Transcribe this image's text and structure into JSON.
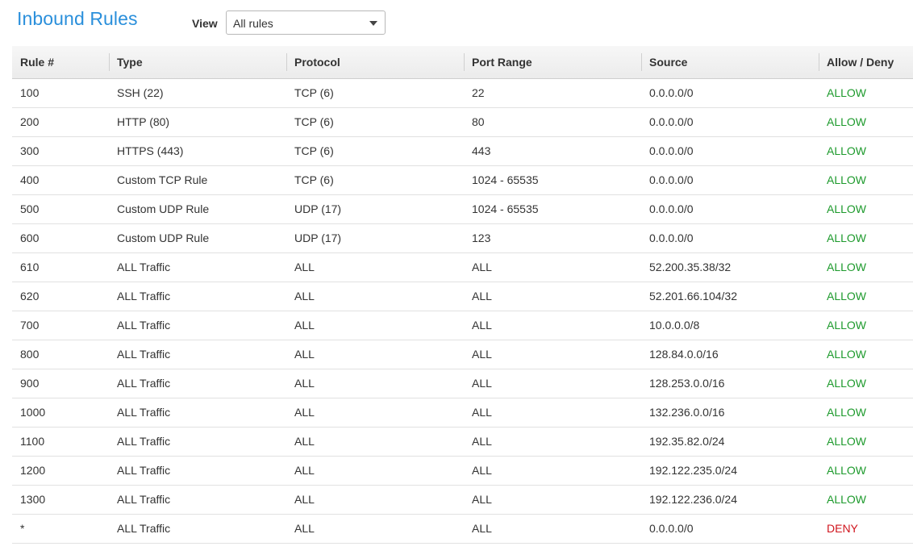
{
  "header": {
    "title": "Inbound Rules",
    "view_label": "View",
    "view_selected": "All rules"
  },
  "table": {
    "columns": [
      "Rule #",
      "Type",
      "Protocol",
      "Port Range",
      "Source",
      "Allow / Deny"
    ],
    "rows": [
      [
        "100",
        "SSH (22)",
        "TCP (6)",
        "22",
        "0.0.0.0/0",
        "ALLOW"
      ],
      [
        "200",
        "HTTP (80)",
        "TCP (6)",
        "80",
        "0.0.0.0/0",
        "ALLOW"
      ],
      [
        "300",
        "HTTPS (443)",
        "TCP (6)",
        "443",
        "0.0.0.0/0",
        "ALLOW"
      ],
      [
        "400",
        "Custom TCP Rule",
        "TCP (6)",
        "1024 - 65535",
        "0.0.0.0/0",
        "ALLOW"
      ],
      [
        "500",
        "Custom UDP Rule",
        "UDP (17)",
        "1024 - 65535",
        "0.0.0.0/0",
        "ALLOW"
      ],
      [
        "600",
        "Custom UDP Rule",
        "UDP (17)",
        "123",
        "0.0.0.0/0",
        "ALLOW"
      ],
      [
        "610",
        "ALL Traffic",
        "ALL",
        "ALL",
        "52.200.35.38/32",
        "ALLOW"
      ],
      [
        "620",
        "ALL Traffic",
        "ALL",
        "ALL",
        "52.201.66.104/32",
        "ALLOW"
      ],
      [
        "700",
        "ALL Traffic",
        "ALL",
        "ALL",
        "10.0.0.0/8",
        "ALLOW"
      ],
      [
        "800",
        "ALL Traffic",
        "ALL",
        "ALL",
        "128.84.0.0/16",
        "ALLOW"
      ],
      [
        "900",
        "ALL Traffic",
        "ALL",
        "ALL",
        "128.253.0.0/16",
        "ALLOW"
      ],
      [
        "1000",
        "ALL Traffic",
        "ALL",
        "ALL",
        "132.236.0.0/16",
        "ALLOW"
      ],
      [
        "1100",
        "ALL Traffic",
        "ALL",
        "ALL",
        "192.35.82.0/24",
        "ALLOW"
      ],
      [
        "1200",
        "ALL Traffic",
        "ALL",
        "ALL",
        "192.122.235.0/24",
        "ALLOW"
      ],
      [
        "1300",
        "ALL Traffic",
        "ALL",
        "ALL",
        "192.122.236.0/24",
        "ALLOW"
      ],
      [
        "*",
        "ALL Traffic",
        "ALL",
        "ALL",
        "0.0.0.0/0",
        "DENY"
      ]
    ]
  },
  "colors": {
    "title": "#2a8fdb",
    "allow": "#1d9a2c",
    "deny": "#d0141d"
  },
  "icons": {
    "view_dropdown": "caret-down-icon"
  }
}
